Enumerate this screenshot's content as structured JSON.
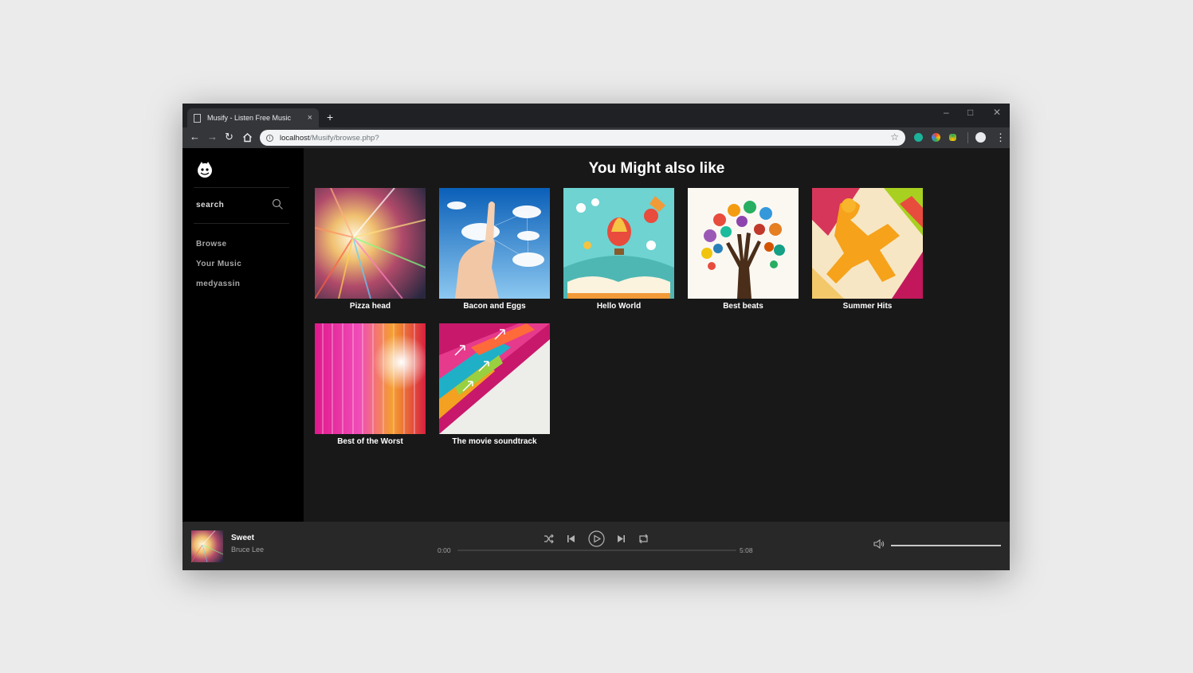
{
  "browser": {
    "tab_title": "Musify - Listen Free Music",
    "tab_close": "×",
    "new_tab": "+",
    "url_host": "localhost",
    "url_path": "/Musify/browse.php?"
  },
  "sidebar": {
    "search_label": "search",
    "items": [
      {
        "label": "Browse"
      },
      {
        "label": "Your Music"
      },
      {
        "label": "medyassin"
      }
    ]
  },
  "main": {
    "title": "You Might also like",
    "albums": [
      {
        "name": "Pizza head"
      },
      {
        "name": "Bacon and Eggs"
      },
      {
        "name": "Hello World"
      },
      {
        "name": "Best beats"
      },
      {
        "name": "Summer Hits"
      },
      {
        "name": "Best of the Worst"
      },
      {
        "name": "The movie soundtrack"
      }
    ]
  },
  "player": {
    "track_title": "Sweet",
    "artist": "Bruce Lee",
    "current_time": "0:00",
    "duration": "5:08",
    "progress": 0,
    "volume": 1.0
  },
  "colors": {
    "app_bg": "#181818",
    "sidebar_bg": "#000000",
    "player_bg": "#282828"
  }
}
